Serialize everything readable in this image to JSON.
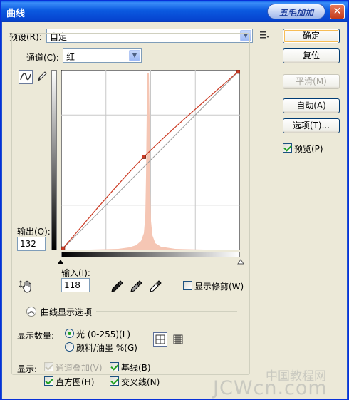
{
  "window": {
    "title": "曲线",
    "logo_text": "五毛加加"
  },
  "preset": {
    "label": "预设(R):",
    "value": "自定"
  },
  "channel": {
    "label": "通道(C):",
    "value": "红"
  },
  "output": {
    "label": "输出(O):",
    "value": "132"
  },
  "input": {
    "label": "输入(I):",
    "value": "118"
  },
  "buttons": {
    "ok": "确定",
    "reset": "复位",
    "smooth": "平滑(M)",
    "auto": "自动(A)",
    "options": "选项(T)..."
  },
  "preview": {
    "label": "预览(P)",
    "checked": true
  },
  "show_clipping": {
    "label": "显示修剪(W)",
    "checked": false
  },
  "curve_display_options": {
    "label": "曲线显示选项"
  },
  "show_amount": {
    "label": "显示数量:",
    "options": [
      "光 (0-255)(L)",
      "颜料/油墨 %(G)"
    ],
    "selected": "光 (0-255)(L)"
  },
  "show": {
    "label": "显示:",
    "channel_overlays": {
      "label": "通道叠加(V)",
      "checked": true,
      "enabled": false
    },
    "baseline": {
      "label": "基线(B)",
      "checked": true
    },
    "histogram": {
      "label": "直方图(H)",
      "checked": true
    },
    "intersection_line": {
      "label": "交叉线(N)",
      "checked": true
    }
  },
  "curve": {
    "color": "#cc3b24",
    "points": [
      {
        "input": 0,
        "output": 0
      },
      {
        "input": 118,
        "output": 132
      },
      {
        "input": 255,
        "output": 255
      }
    ]
  },
  "histogram_color": "#f5c6b4",
  "watermark": {
    "line1": "中国教程网",
    "line2": "JCWcn.com"
  }
}
